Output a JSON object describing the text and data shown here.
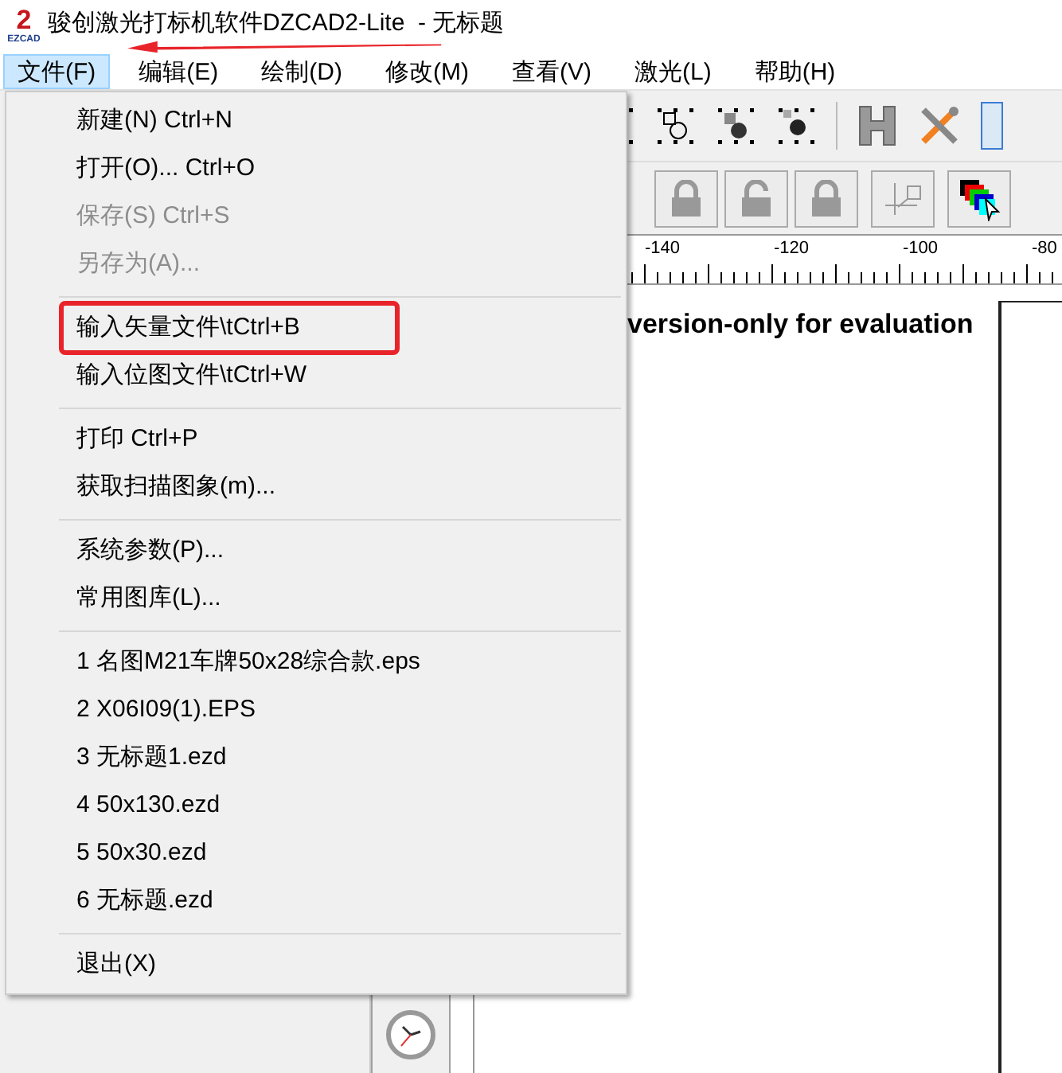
{
  "window": {
    "title": "骏创激光打标机软件DZCAD2-Lite  - 无标题",
    "logo": {
      "mark": "2",
      "caption": "EZCAD"
    }
  },
  "menubar": [
    {
      "label": "文件(F)",
      "selected": true
    },
    {
      "label": "编辑(E)",
      "selected": false
    },
    {
      "label": "绘制(D)",
      "selected": false
    },
    {
      "label": "修改(M)",
      "selected": false
    },
    {
      "label": "查看(V)",
      "selected": false
    },
    {
      "label": "激光(L)",
      "selected": false
    },
    {
      "label": "帮助(H)",
      "selected": false
    }
  ],
  "file_menu": [
    {
      "kind": "item",
      "label": "新建(N) Ctrl+N",
      "disabled": false,
      "annotated": false
    },
    {
      "kind": "item",
      "label": "打开(O)... Ctrl+O",
      "disabled": false,
      "annotated": false
    },
    {
      "kind": "item",
      "label": "保存(S) Ctrl+S",
      "disabled": true,
      "annotated": false
    },
    {
      "kind": "item",
      "label": "另存为(A)...",
      "disabled": true,
      "annotated": false
    },
    {
      "kind": "separator"
    },
    {
      "kind": "item",
      "label": "输入矢量文件\\tCtrl+B",
      "disabled": false,
      "annotated": true
    },
    {
      "kind": "item",
      "label": "输入位图文件\\tCtrl+W",
      "disabled": false,
      "annotated": false
    },
    {
      "kind": "separator"
    },
    {
      "kind": "item",
      "label": "打印 Ctrl+P",
      "disabled": false,
      "annotated": false
    },
    {
      "kind": "item",
      "label": "获取扫描图象(m)...",
      "disabled": false,
      "annotated": false
    },
    {
      "kind": "separator"
    },
    {
      "kind": "item",
      "label": "系统参数(P)...",
      "disabled": false,
      "annotated": false
    },
    {
      "kind": "item",
      "label": "常用图库(L)...",
      "disabled": false,
      "annotated": false
    },
    {
      "kind": "separator"
    },
    {
      "kind": "item",
      "label": "1 名图M21车牌50x28综合款.eps",
      "disabled": false,
      "annotated": false
    },
    {
      "kind": "item",
      "label": "2 X06I09(1).EPS",
      "disabled": false,
      "annotated": false
    },
    {
      "kind": "item",
      "label": "3 无标题1.ezd",
      "disabled": false,
      "annotated": false
    },
    {
      "kind": "item",
      "label": "4 50x130.ezd",
      "disabled": false,
      "annotated": false
    },
    {
      "kind": "item",
      "label": "5 50x30.ezd",
      "disabled": false,
      "annotated": false
    },
    {
      "kind": "item",
      "label": "6 无标题.ezd",
      "disabled": false,
      "annotated": false
    },
    {
      "kind": "separator"
    },
    {
      "kind": "item",
      "label": "退出(X)",
      "disabled": false,
      "annotated": false
    }
  ],
  "ruler": {
    "labels": [
      "-140",
      "-120",
      "-100",
      "-80"
    ]
  },
  "canvas": {
    "watermark_text": "version-only for evaluation"
  }
}
